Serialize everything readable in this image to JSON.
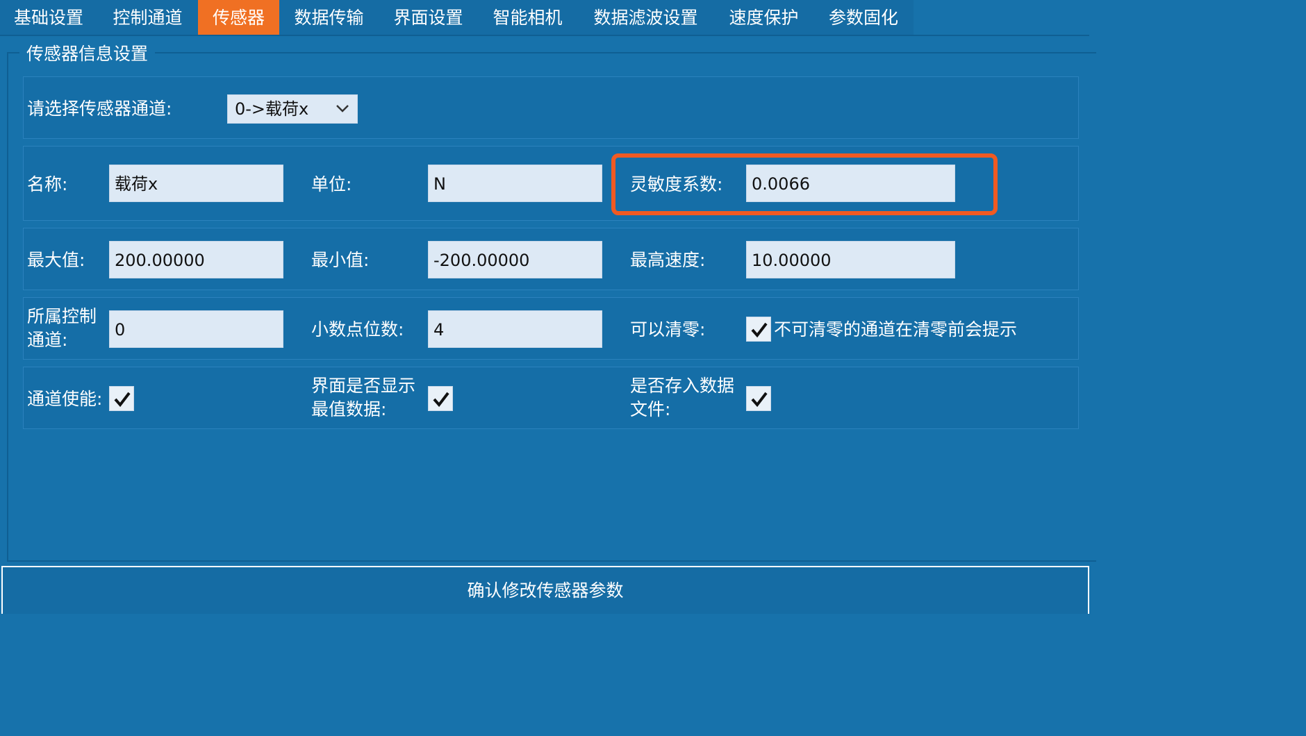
{
  "tabs": [
    {
      "label": "基础设置",
      "active": false
    },
    {
      "label": "控制通道",
      "active": false
    },
    {
      "label": "传感器",
      "active": true
    },
    {
      "label": "数据传输",
      "active": false
    },
    {
      "label": "界面设置",
      "active": false
    },
    {
      "label": "智能相机",
      "active": false
    },
    {
      "label": "数据滤波设置",
      "active": false
    },
    {
      "label": "速度保护",
      "active": false
    },
    {
      "label": "参数固化",
      "active": false
    }
  ],
  "group_title": "传感器信息设置",
  "channel_select": {
    "label": "请选择传感器通道:",
    "value": "0->载荷x"
  },
  "fields": {
    "name": {
      "label": "名称:",
      "value": "载荷x"
    },
    "unit": {
      "label": "单位:",
      "value": "N"
    },
    "sensitivity": {
      "label": "灵敏度系数:",
      "value": "0.0066"
    },
    "max_value": {
      "label": "最大值:",
      "value": "200.00000"
    },
    "min_value": {
      "label": "最小值:",
      "value": "-200.00000"
    },
    "max_speed": {
      "label": "最高速度:",
      "value": "10.00000"
    },
    "control_channel": {
      "label": "所属控制通道:",
      "value": "0"
    },
    "decimal_places": {
      "label": "小数点位数:",
      "value": "4"
    }
  },
  "checkboxes": {
    "zeroable": {
      "label": "可以清零:",
      "checked": true,
      "note": "不可清零的通道在清零前会提示"
    },
    "channel_enable": {
      "label": "通道使能:",
      "checked": true
    },
    "show_extremes": {
      "label": "界面是否显示最值数据:",
      "checked": true
    },
    "save_to_file": {
      "label": "是否存入数据文件:",
      "checked": true
    }
  },
  "confirm_button": "确认修改传感器参数",
  "colors": {
    "background": "#1772ab",
    "active_tab": "#f07023",
    "highlight": "#f05a22",
    "field_bg": "#dde9f5"
  }
}
